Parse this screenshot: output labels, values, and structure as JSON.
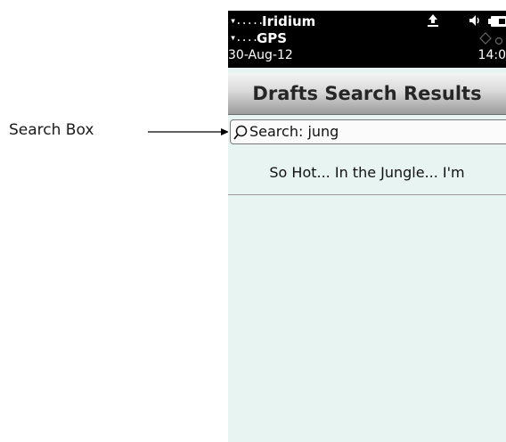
{
  "annotation": {
    "label": "Search Box"
  },
  "status_bar": {
    "row1_signal": "▾.....",
    "network_name": "Iridium",
    "row2_signal": "▾....",
    "gps_label": "GPS",
    "date": "30-Aug-12",
    "time": "14:0",
    "icons": [
      "satellite-signal-icon",
      "upload-icon",
      "volume-icon",
      "battery-icon",
      "gps-icon"
    ]
  },
  "header": {
    "title": "Drafts Search Results"
  },
  "search": {
    "label": "Search:",
    "query": "jung",
    "display": "Search: jung"
  },
  "results": [
    {
      "text": "So Hot... In the Jungle... I'm"
    }
  ],
  "colors": {
    "status_bg": "#000000",
    "list_bg": "#e8f4f1",
    "title_text": "#262626"
  }
}
